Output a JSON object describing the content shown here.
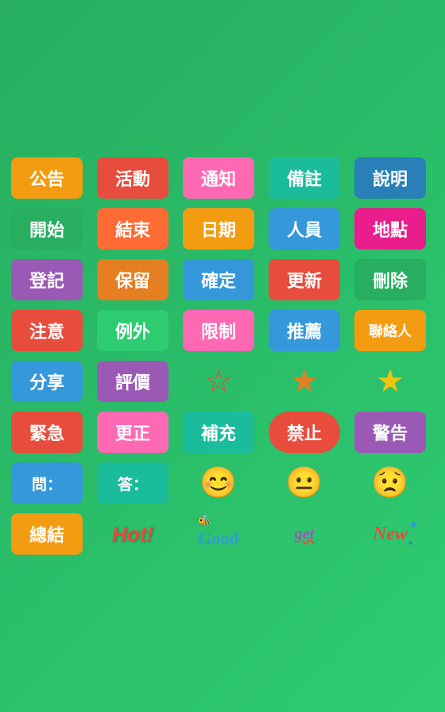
{
  "rows": [
    {
      "id": "row1",
      "items": [
        {
          "id": "gongao",
          "label": "公告",
          "type": "tag",
          "class": "tag-gongao"
        },
        {
          "id": "activity",
          "label": "活動",
          "type": "tag",
          "class": "tag-activity"
        },
        {
          "id": "notice",
          "label": "通知",
          "type": "tag",
          "class": "tag-notice"
        },
        {
          "id": "note",
          "label": "備註",
          "type": "tag",
          "class": "tag-note"
        },
        {
          "id": "explain",
          "label": "說明",
          "type": "tag",
          "class": "tag-explain"
        }
      ]
    },
    {
      "id": "row2",
      "items": [
        {
          "id": "start",
          "label": "開始",
          "type": "tag",
          "class": "tag-start"
        },
        {
          "id": "end",
          "label": "結束",
          "type": "tag",
          "class": "tag-end"
        },
        {
          "id": "date",
          "label": "日期",
          "type": "tag",
          "class": "tag-date"
        },
        {
          "id": "person",
          "label": "人員",
          "type": "tag",
          "class": "tag-person"
        },
        {
          "id": "location",
          "label": "地點",
          "type": "tag",
          "class": "tag-location"
        }
      ]
    },
    {
      "id": "row3",
      "items": [
        {
          "id": "register",
          "label": "登記",
          "type": "tag",
          "class": "tag-register"
        },
        {
          "id": "reserve",
          "label": "保留",
          "type": "tag",
          "class": "tag-reserve"
        },
        {
          "id": "confirm",
          "label": "確定",
          "type": "tag",
          "class": "tag-confirm"
        },
        {
          "id": "update",
          "label": "更新",
          "type": "tag",
          "class": "tag-update"
        },
        {
          "id": "delete",
          "label": "刪除",
          "type": "tag",
          "class": "tag-delete"
        }
      ]
    },
    {
      "id": "row4",
      "items": [
        {
          "id": "attention",
          "label": "注意",
          "type": "tag",
          "class": "tag-attention"
        },
        {
          "id": "exception",
          "label": "例外",
          "type": "tag",
          "class": "tag-exception"
        },
        {
          "id": "limit",
          "label": "限制",
          "type": "tag",
          "class": "tag-limit"
        },
        {
          "id": "recommend",
          "label": "推薦",
          "type": "tag",
          "class": "tag-recommend"
        },
        {
          "id": "contact",
          "label": "聯絡人",
          "type": "tag",
          "class": "tag-contact"
        }
      ]
    },
    {
      "id": "row5",
      "items": [
        {
          "id": "share",
          "label": "分享",
          "type": "tag",
          "class": "tag-share"
        },
        {
          "id": "review",
          "label": "評價",
          "type": "tag",
          "class": "tag-review"
        },
        {
          "id": "star-outline",
          "label": "☆",
          "type": "icon",
          "class": "star-outline"
        },
        {
          "id": "star-half",
          "label": "★",
          "type": "icon",
          "class": "star-half"
        },
        {
          "id": "star-filled",
          "label": "★",
          "type": "icon",
          "class": "star-filled"
        }
      ]
    },
    {
      "id": "row6",
      "items": [
        {
          "id": "urgent",
          "label": "緊急",
          "type": "tag",
          "class": "tag-urgent"
        },
        {
          "id": "correct",
          "label": "更正",
          "type": "tag",
          "class": "tag-correct"
        },
        {
          "id": "supplement",
          "label": "補充",
          "type": "tag",
          "class": "tag-supplement"
        },
        {
          "id": "forbidden",
          "label": "禁止",
          "type": "tag",
          "class": "tag-forbidden"
        },
        {
          "id": "warning",
          "label": "警告",
          "type": "tag",
          "class": "tag-warning"
        }
      ]
    },
    {
      "id": "row7",
      "items": [
        {
          "id": "question",
          "label": "問：",
          "type": "tag",
          "class": "tag-question"
        },
        {
          "id": "answer",
          "label": "答：",
          "type": "tag",
          "class": "tag-answer"
        },
        {
          "id": "smile",
          "label": "😊",
          "type": "emoji"
        },
        {
          "id": "neutral",
          "label": "😐",
          "type": "emoji"
        },
        {
          "id": "sad",
          "label": "😟",
          "type": "emoji"
        }
      ]
    },
    {
      "id": "row8",
      "items": [
        {
          "id": "summary",
          "label": "總結",
          "type": "tag",
          "class": "tag-summary"
        },
        {
          "id": "hot",
          "label": "Hot!",
          "type": "special"
        },
        {
          "id": "good",
          "label": "Good",
          "type": "special"
        },
        {
          "id": "get",
          "label": "get",
          "type": "special"
        },
        {
          "id": "new",
          "label": "New",
          "type": "special"
        }
      ]
    }
  ]
}
